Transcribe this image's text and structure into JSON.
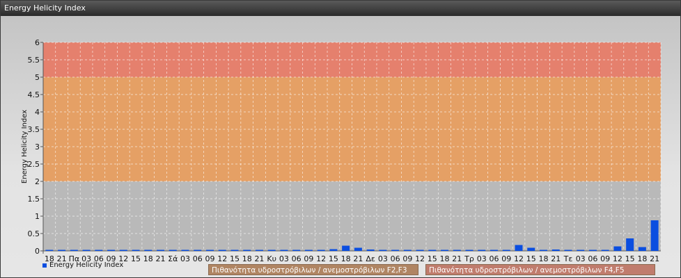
{
  "window": {
    "title": "Energy Helicity Index"
  },
  "colors": {
    "bar": "#0b4ee0",
    "band_low": "#b9b9b9",
    "band_mid": "#e5a065",
    "band_high": "#e5806d",
    "grid": "#ffffff",
    "band_label_mid": "#b08563",
    "band_label_high": "#c07c6d"
  },
  "bands": [
    {
      "from": 2,
      "to": 5,
      "label": "Πιθανότητα υδροστρόβιλων / ανεμοστρόβιλων F2,F3"
    },
    {
      "from": 5,
      "to": 6,
      "label": "Πιθανότητα υδροστρόβιλων / ανεμοστρόβιλων F4,F5"
    }
  ],
  "chart_data": {
    "type": "bar",
    "ylabel": "Energy Helicity Index",
    "xlabel": "",
    "ylim": [
      0,
      6
    ],
    "yticks": [
      0,
      0.5,
      1,
      1.5,
      2,
      2.5,
      3,
      3.5,
      4,
      4.5,
      5,
      5.5,
      6
    ],
    "grid": true,
    "legend_position": "bottom-left",
    "categories": [
      "18",
      "21",
      "Πα",
      "03",
      "06",
      "09",
      "12",
      "15",
      "18",
      "21",
      "Σά",
      "03",
      "06",
      "09",
      "12",
      "15",
      "18",
      "21",
      "Κυ",
      "03",
      "06",
      "09",
      "12",
      "15",
      "18",
      "21",
      "Δε",
      "03",
      "06",
      "09",
      "12",
      "15",
      "18",
      "21",
      "Τρ",
      "03",
      "06",
      "09",
      "12",
      "15",
      "18",
      "21",
      "Τε",
      "03",
      "06",
      "09",
      "12",
      "15",
      "18",
      "21"
    ],
    "series": [
      {
        "name": "Energy Helicity Index",
        "values": [
          0.01,
          0.01,
          0.01,
          0.01,
          0.01,
          0.01,
          0.01,
          0.01,
          0.01,
          0.01,
          0.01,
          0.01,
          0.01,
          0.01,
          0.01,
          0.01,
          0.01,
          0.01,
          0.01,
          0.01,
          0.01,
          0.01,
          0.01,
          0.05,
          0.15,
          0.09,
          0.04,
          0.01,
          0.01,
          0.01,
          0.01,
          0.01,
          0.01,
          0.01,
          0.01,
          0.01,
          0.01,
          0.01,
          0.17,
          0.09,
          0.02,
          0.04,
          0.01,
          0.01,
          0.01,
          0.01,
          0.13,
          0.36,
          0.11,
          0.88
        ]
      }
    ]
  }
}
